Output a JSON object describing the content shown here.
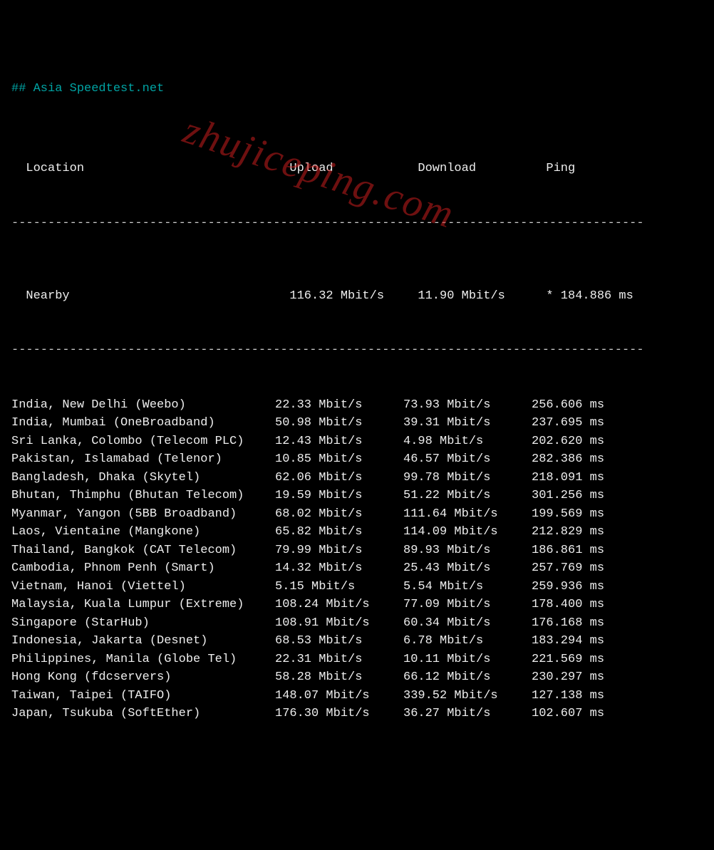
{
  "title": "## Asia Speedtest.net",
  "headers": {
    "location": "Location",
    "upload": "Upload",
    "download": "Download",
    "ping": "Ping"
  },
  "separator": "---------------------------------------------------------------------------------------",
  "nearby": {
    "location": "Nearby",
    "upload": "116.32 Mbit/s",
    "download": "11.90 Mbit/s",
    "ping": "* 184.886 ms"
  },
  "rows": [
    {
      "location": "India, New Delhi (Weebo)",
      "upload": "22.33 Mbit/s",
      "download": "73.93 Mbit/s",
      "ping": "256.606 ms"
    },
    {
      "location": "India, Mumbai (OneBroadband)",
      "upload": "50.98 Mbit/s",
      "download": "39.31 Mbit/s",
      "ping": "237.695 ms"
    },
    {
      "location": "Sri Lanka, Colombo (Telecom PLC)",
      "upload": "12.43 Mbit/s",
      "download": "4.98 Mbit/s",
      "ping": "202.620 ms"
    },
    {
      "location": "Pakistan, Islamabad (Telenor)",
      "upload": "10.85 Mbit/s",
      "download": "46.57 Mbit/s",
      "ping": "282.386 ms"
    },
    {
      "location": "Bangladesh, Dhaka (Skytel)",
      "upload": "62.06 Mbit/s",
      "download": "99.78 Mbit/s",
      "ping": "218.091 ms"
    },
    {
      "location": "Bhutan, Thimphu (Bhutan Telecom)",
      "upload": "19.59 Mbit/s",
      "download": "51.22 Mbit/s",
      "ping": "301.256 ms"
    },
    {
      "location": "Myanmar, Yangon (5BB Broadband)",
      "upload": "68.02 Mbit/s",
      "download": "111.64 Mbit/s",
      "ping": "199.569 ms"
    },
    {
      "location": "Laos, Vientaine (Mangkone)",
      "upload": "65.82 Mbit/s",
      "download": "114.09 Mbit/s",
      "ping": "212.829 ms"
    },
    {
      "location": "Thailand, Bangkok (CAT Telecom)",
      "upload": "79.99 Mbit/s",
      "download": "89.93 Mbit/s",
      "ping": "186.861 ms"
    },
    {
      "location": "Cambodia, Phnom Penh (Smart)",
      "upload": "14.32 Mbit/s",
      "download": "25.43 Mbit/s",
      "ping": "257.769 ms"
    },
    {
      "location": "Vietnam, Hanoi (Viettel)",
      "upload": "5.15 Mbit/s",
      "download": "5.54 Mbit/s",
      "ping": "259.936 ms"
    },
    {
      "location": "Malaysia, Kuala Lumpur (Extreme)",
      "upload": "108.24 Mbit/s",
      "download": "77.09 Mbit/s",
      "ping": "178.400 ms"
    },
    {
      "location": "Singapore (StarHub)",
      "upload": "108.91 Mbit/s",
      "download": "60.34 Mbit/s",
      "ping": "176.168 ms"
    },
    {
      "location": "Indonesia, Jakarta (Desnet)",
      "upload": "68.53 Mbit/s",
      "download": "6.78 Mbit/s",
      "ping": "183.294 ms"
    },
    {
      "location": "Philippines, Manila (Globe Tel)",
      "upload": "22.31 Mbit/s",
      "download": "10.11 Mbit/s",
      "ping": "221.569 ms"
    },
    {
      "location": "Hong Kong (fdcservers)",
      "upload": "58.28 Mbit/s",
      "download": "66.12 Mbit/s",
      "ping": "230.297 ms"
    },
    {
      "location": "Taiwan, Taipei (TAIFO)",
      "upload": "148.07 Mbit/s",
      "download": "339.52 Mbit/s",
      "ping": "127.138 ms"
    },
    {
      "location": "Japan, Tsukuba (SoftEther)",
      "upload": "176.30 Mbit/s",
      "download": "36.27 Mbit/s",
      "ping": "102.607 ms"
    }
  ],
  "watermark": "zhujiceping.com"
}
